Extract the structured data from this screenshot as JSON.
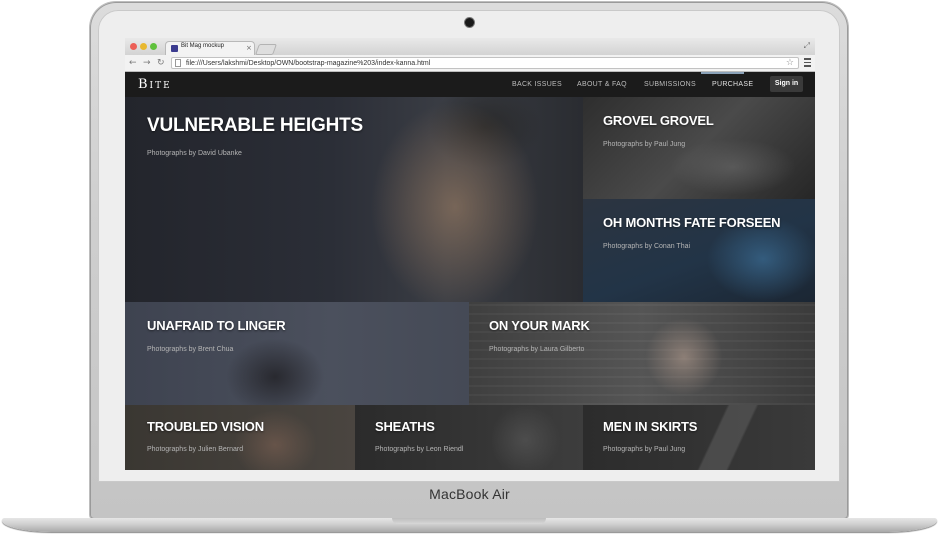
{
  "device": {
    "model_name": "MacBook",
    "model_variant": "Air"
  },
  "browser": {
    "tab_title": "Bit Mag mockup",
    "tab_close": "×",
    "url": "file:///Users/lakshmi/Desktop/OWN/bootstrap-magazine%203/index-kanna.html",
    "back": "←",
    "forward": "→",
    "reload": "↻",
    "star": "☆",
    "fullscreen": "⤢"
  },
  "site": {
    "brand": "Bite",
    "nav": [
      "BACK ISSUES",
      "ABOUT & FAQ",
      "SUBMISSIONS",
      "PURCHASE"
    ],
    "active_nav": "PURCHASE",
    "signin_label": "Sign in"
  },
  "articles": [
    {
      "title": "VULNERABLE HEIGHTS",
      "credit": "Photographs by David Ubanke"
    },
    {
      "title": "GROVEL GROVEL",
      "credit": "Photographs by Paul Jung"
    },
    {
      "title": "OH MONTHS FATE FORSEEN",
      "credit": "Photographs by Conan Thai"
    },
    {
      "title": "UNAFRAID TO LINGER",
      "credit": "Photographs by Brent Chua"
    },
    {
      "title": "ON YOUR MARK",
      "credit": "Photographs by Laura Gilberto"
    },
    {
      "title": "TROUBLED VISION",
      "credit": "Photographs by Julien Bernard"
    },
    {
      "title": "SHEATHS",
      "credit": "Photographs by Leon Riendl"
    },
    {
      "title": "MEN IN SKIRTS",
      "credit": "Photographs by Paul Jung"
    }
  ],
  "colors": {
    "navbar_bg": "#1b1b1b",
    "signin_bg": "#3a3a3a",
    "active_indicator": "#8aa1b8"
  }
}
